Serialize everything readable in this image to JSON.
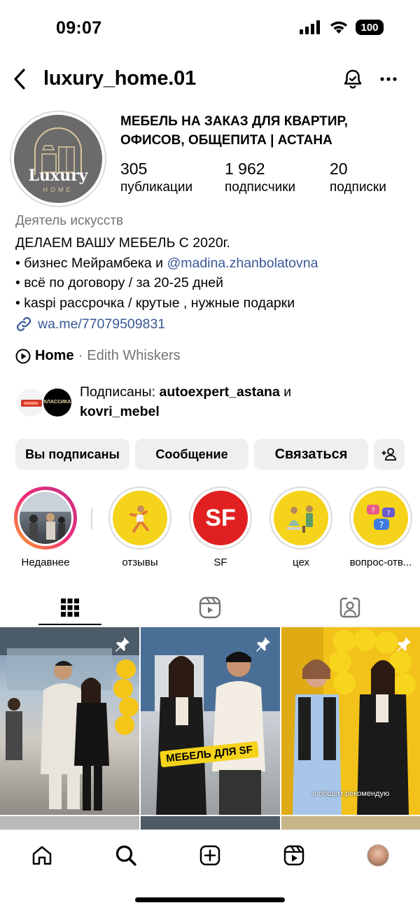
{
  "status": {
    "time": "09:07",
    "battery": "100"
  },
  "header": {
    "username": "luxury_home.01"
  },
  "profile": {
    "logo_text": "Luxury",
    "logo_sub": "HOME",
    "business_name": "МЕБЕЛЬ НА ЗАКАЗ ДЛЯ КВАРТИР, ОФИСОВ, ОБЩЕПИТА | АСТАНА",
    "stats": [
      {
        "value": "305",
        "label": "публикации"
      },
      {
        "value": "1 962",
        "label": "подписчики"
      },
      {
        "value": "20",
        "label": "подписки"
      }
    ],
    "category": "Деятель искусств",
    "bio_line1": "ДЕЛАЕМ ВАШУ МЕБЕЛЬ С 2020г.",
    "bio_line2_prefix": "• бизнес Мейрамбека и ",
    "bio_mention": "@madina.zhanbolatovna",
    "bio_line3": "• всё по договору / за 20-25 дней",
    "bio_line4": "• kaspi рассрочка / крутые , нужные подарки",
    "link": "wa.me/77079509831",
    "music_song": "Home",
    "music_sep": " · ",
    "music_artist": "Edith Whiskers",
    "followed_by_prefix": "Подписаны: ",
    "followed_by_user1": "autoexpert_astana",
    "followed_by_and": " и",
    "followed_by_user2": "kovri_mebel",
    "fav2_text": "КЛАССИКА"
  },
  "buttons": {
    "following": "Вы подписаны",
    "message": "Сообщение",
    "contact": "Связаться"
  },
  "highlights": [
    {
      "label": "Недавнее"
    },
    {
      "label": "отзывы"
    },
    {
      "label": "SF",
      "icon_text": "SF"
    },
    {
      "label": "цех"
    },
    {
      "label": "вопрос-отв..."
    }
  ],
  "posts": [
    {
      "caption": ""
    },
    {
      "caption": "МЕБЕЛЬ ДЛЯ SF"
    },
    {
      "caption": "в общем рекомендую"
    }
  ],
  "colors": {
    "link": "#385898",
    "muted": "#737373",
    "button_bg": "#efefef",
    "highlight_yellow": "#f5d31a",
    "sf_red": "#e02020"
  }
}
